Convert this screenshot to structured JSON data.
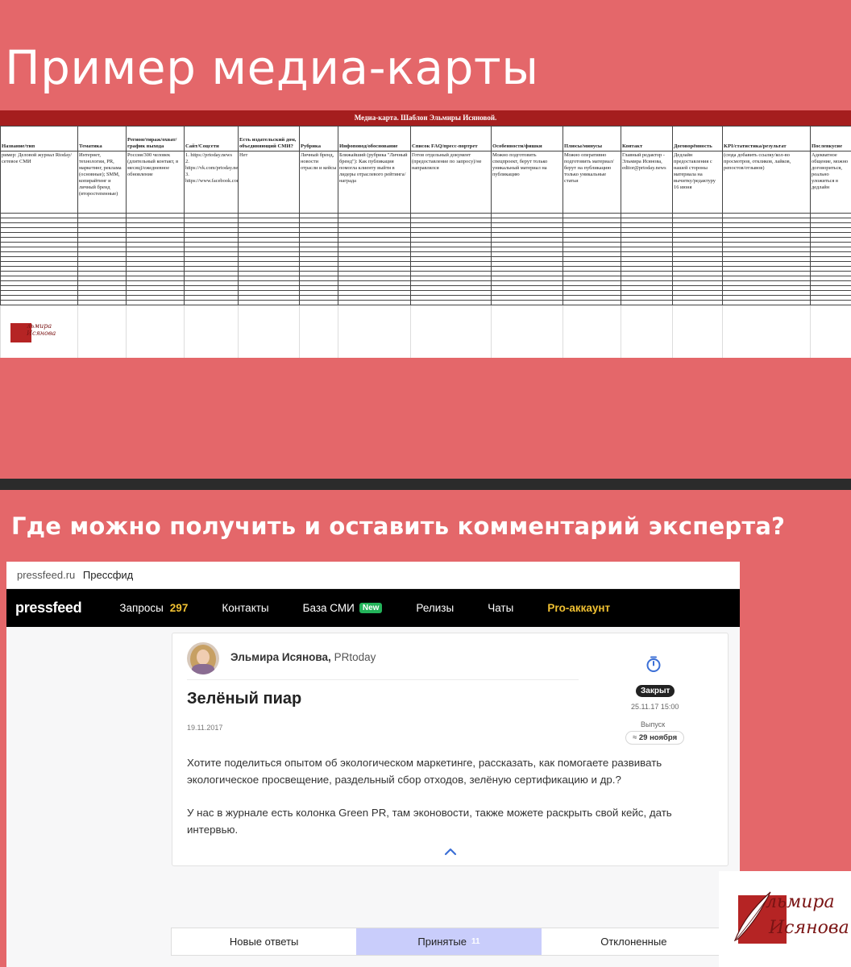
{
  "slide1": {
    "title": "Пример медиа-карты",
    "sheet_title": "Медиа-карта. Шаблон Эльмиры Исяновой.",
    "columns": [
      "Название/тип",
      "Тематика",
      "Регион/тираж/охват/график выхода",
      "Сайт/Соцсети",
      "Есть издательский дом, объединяющий СМИ?",
      "Рубрика",
      "Инфоповод/обоснование",
      "Список FAQ/пресс-портрет",
      "Особенности/фишки",
      "Плюсы/минусы",
      "Контакт",
      "Договорённость",
      "KPI/статистика/результат",
      "Послевкусие"
    ],
    "example_row": [
      "ример: Деловой журнал Rtoday/сетевое СМИ",
      "Интернет, технологии, PR, маркетинг, реклама (основные); SMM, копирайтинг и личный бренд (второстепенные)",
      "Россия/300 человек (длительный контакт, в месяц)/ежедневное обновление",
      "1. https://prtoday.news 2. https://vk.com/prtoday.news 3. https://www.facebook.com/PRtoday.news/",
      "Нет",
      "Личный бренд, новости отрасли и кейсы",
      "Ближайший (рубрика \"Личный бренд\"): Как публикация помогла клиенту выйти в лидеры отраслевого рейтинга/награда",
      "Готов отдельный документ (предоставление по запросу)/не направлялся",
      "Можно подготовить спецпроект, берут только уникальный материал на публикацию",
      "Можно оперативно подготовить материал/берут на публикацию только уникальные статьи",
      "Главный редактор - Эльмира Исянова, editor@prtoday.news",
      "Дедлайн предоставления с нашей стороны материала на вычитку/редактуру 16 июня",
      "(сюда добавить ссылку/кол-во просмотров, откликов, лайков, репостов/отзывов)",
      "Адекватное общение, можно договориться, реально уложиться в дедлайн"
    ],
    "logo_text_1": "льмира",
    "logo_text_2": "Исянова"
  },
  "slide2": {
    "title": "Где можно получить и оставить комментарий эксперта?",
    "browser": {
      "url": "pressfeed.ru",
      "site_name": "Прессфид"
    },
    "nav": {
      "logo": "pressfeed",
      "requests_label": "Запросы",
      "requests_count": "297",
      "contacts_label": "Контакты",
      "media_base_label": "База СМИ",
      "media_base_badge": "New",
      "releases_label": "Релизы",
      "chats_label": "Чаты",
      "pro_label": "Pro-аккаунт"
    },
    "post": {
      "author_name": "Эльмира Исянова,",
      "author_outlet": "PRtoday",
      "title": "Зелёный пиар",
      "date": "19.11.2017",
      "status": "Закрыт",
      "closed_date": "25.11.17 15:00",
      "issue_label": "Выпуск",
      "issue_prefix": "≈",
      "issue_date": "29 ноября",
      "body_1": "Хотите поделиться опытом об экологическом маркетинге, рассказать, как помогаете развивать экологическое просвещение, раздельный сбор отходов, зелёную сертификацию и др.?",
      "body_2": "У нас в журнале есть колонка Green PR, там эконовости, также можете раскрыть свой кейс, дать интервью."
    },
    "tabs": {
      "new_answers": "Новые ответы",
      "accepted": "Принятые",
      "accepted_count": "11",
      "rejected": "Отклоненные"
    }
  },
  "corner_logo": {
    "line_1": "льмира",
    "line_2": "Исянова"
  },
  "colors": {
    "slide_background": "#e4676a",
    "sheet_banner": "#a51e1e",
    "nav_background": "#000000",
    "accent_yellow": "#f0c032",
    "badge_green": "#23b35a",
    "tab_active": "#c9cdfb",
    "icon_blue": "#3b6fd6"
  }
}
